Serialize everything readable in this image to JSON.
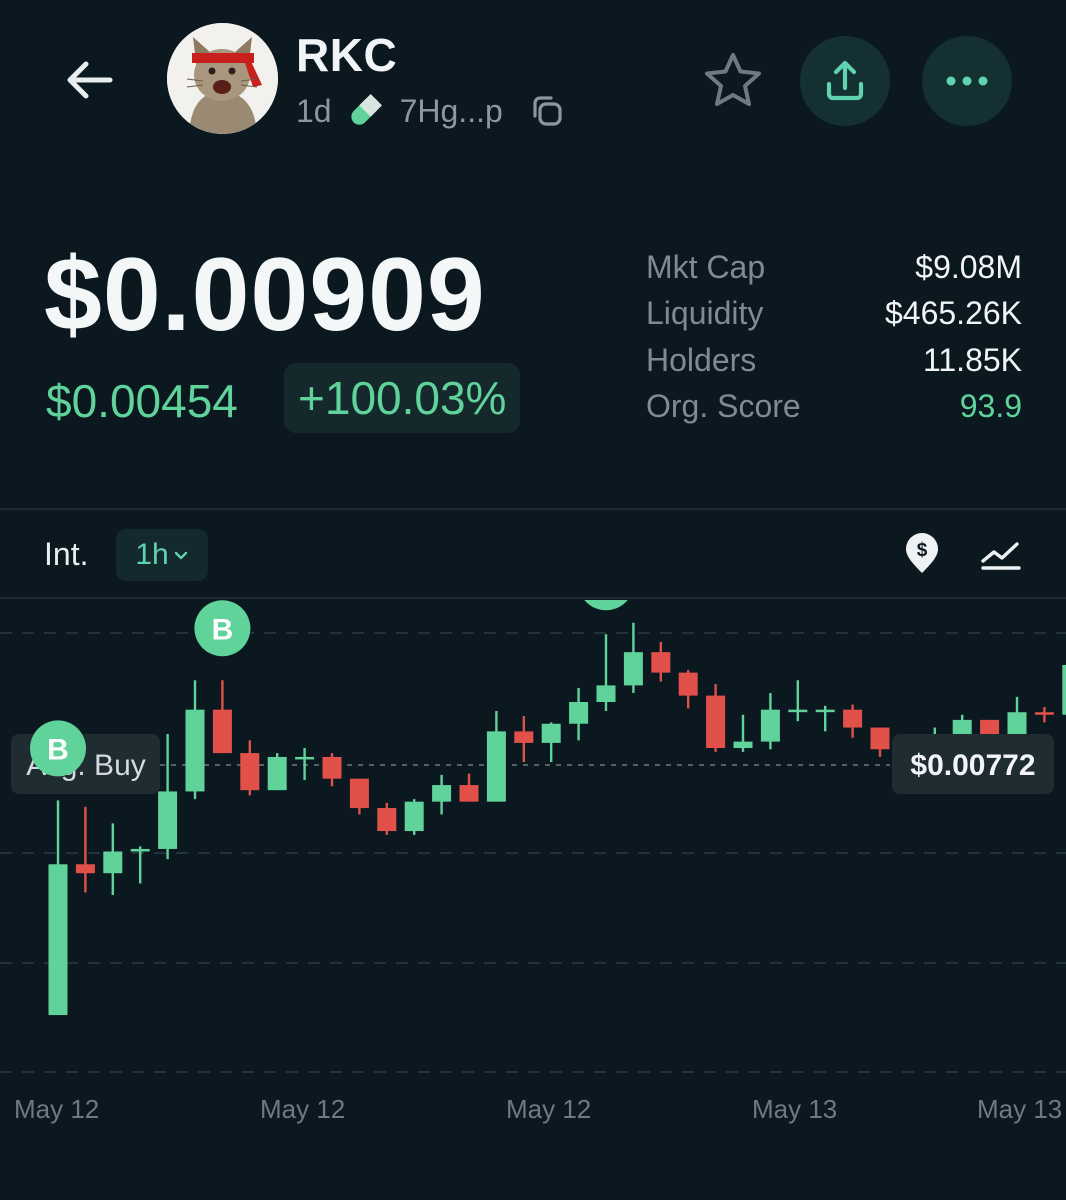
{
  "header": {
    "token_name": "RKC",
    "age": "1d",
    "address": "7Hg...p",
    "icons": {
      "back": "arrow-left-icon",
      "pill": "pill-icon",
      "copy": "copy-icon",
      "star": "star-icon",
      "share": "share-icon",
      "more": "more-icon"
    }
  },
  "price": {
    "current": "$0.00909",
    "previous": "$0.00454",
    "change": "+100.03%"
  },
  "stats": [
    {
      "label": "Mkt Cap",
      "value": "$9.08M"
    },
    {
      "label": "Liquidity",
      "value": "$465.26K"
    },
    {
      "label": "Holders",
      "value": "11.85K"
    },
    {
      "label": "Org. Score",
      "value": "93.9"
    }
  ],
  "interval": {
    "label": "Int.",
    "selected": "1h"
  },
  "colors": {
    "background": "#0b1820",
    "up": "#5fd39a",
    "down": "#e1514a",
    "accent": "#5fd3b0"
  },
  "chart_data": {
    "type": "candlestick",
    "avg_buy_label": "Avg. Buy",
    "price_label": "$0.00772",
    "x_labels": [
      "May 12",
      "May 12",
      "May 12",
      "May 13",
      "May 13"
    ],
    "buy_marker_text": "B",
    "buy_markers": [
      0,
      6,
      20
    ],
    "candles": [
      {
        "o": 0.00423,
        "h": 0.00591,
        "l": 0.00423,
        "c": 0.00541
      },
      {
        "o": 0.00541,
        "h": 0.00586,
        "l": 0.00519,
        "c": 0.00534
      },
      {
        "o": 0.00534,
        "h": 0.00573,
        "l": 0.00517,
        "c": 0.00551
      },
      {
        "o": 0.00551,
        "h": 0.00555,
        "l": 0.00526,
        "c": 0.00553
      },
      {
        "o": 0.00553,
        "h": 0.00643,
        "l": 0.00545,
        "c": 0.00598
      },
      {
        "o": 0.00598,
        "h": 0.00685,
        "l": 0.00592,
        "c": 0.00662
      },
      {
        "o": 0.00662,
        "h": 0.00685,
        "l": 0.00628,
        "c": 0.00628
      },
      {
        "o": 0.00628,
        "h": 0.00638,
        "l": 0.00595,
        "c": 0.00599
      },
      {
        "o": 0.00599,
        "h": 0.00628,
        "l": 0.00599,
        "c": 0.00625
      },
      {
        "o": 0.00625,
        "h": 0.00632,
        "l": 0.00607,
        "c": 0.00625
      },
      {
        "o": 0.00625,
        "h": 0.00628,
        "l": 0.00602,
        "c": 0.00608
      },
      {
        "o": 0.00608,
        "h": 0.00603,
        "l": 0.0058,
        "c": 0.00585
      },
      {
        "o": 0.00585,
        "h": 0.00589,
        "l": 0.00564,
        "c": 0.00567
      },
      {
        "o": 0.00567,
        "h": 0.00592,
        "l": 0.00564,
        "c": 0.0059
      },
      {
        "o": 0.0059,
        "h": 0.00611,
        "l": 0.0058,
        "c": 0.00603
      },
      {
        "o": 0.00603,
        "h": 0.00612,
        "l": 0.00591,
        "c": 0.0059
      },
      {
        "o": 0.0059,
        "h": 0.00661,
        "l": 0.0059,
        "c": 0.00645
      },
      {
        "o": 0.00645,
        "h": 0.00657,
        "l": 0.00621,
        "c": 0.00636
      },
      {
        "o": 0.00636,
        "h": 0.00652,
        "l": 0.00621,
        "c": 0.00651
      },
      {
        "o": 0.00651,
        "h": 0.00679,
        "l": 0.00638,
        "c": 0.00668
      },
      {
        "o": 0.00668,
        "h": 0.00721,
        "l": 0.00661,
        "c": 0.00681
      },
      {
        "o": 0.00681,
        "h": 0.0073,
        "l": 0.00675,
        "c": 0.00707
      },
      {
        "o": 0.00707,
        "h": 0.00715,
        "l": 0.00684,
        "c": 0.00691
      },
      {
        "o": 0.00691,
        "h": 0.00693,
        "l": 0.00663,
        "c": 0.00673
      },
      {
        "o": 0.00673,
        "h": 0.00682,
        "l": 0.00629,
        "c": 0.00632
      },
      {
        "o": 0.00632,
        "h": 0.00658,
        "l": 0.00629,
        "c": 0.00637
      },
      {
        "o": 0.00637,
        "h": 0.00675,
        "l": 0.00631,
        "c": 0.00662
      },
      {
        "o": 0.00662,
        "h": 0.00685,
        "l": 0.00653,
        "c": 0.00662
      },
      {
        "o": 0.00662,
        "h": 0.00665,
        "l": 0.00645,
        "c": 0.00662
      },
      {
        "o": 0.00662,
        "h": 0.00666,
        "l": 0.0064,
        "c": 0.00648
      },
      {
        "o": 0.00648,
        "h": 0.00648,
        "l": 0.00625,
        "c": 0.00631
      },
      {
        "o": 0.00631,
        "h": 0.00637,
        "l": 0.00614,
        "c": 0.00635
      },
      {
        "o": 0.00635,
        "h": 0.00648,
        "l": 0.00632,
        "c": 0.00636
      },
      {
        "o": 0.00636,
        "h": 0.00658,
        "l": 0.00629,
        "c": 0.00654
      },
      {
        "o": 0.00654,
        "h": 0.00654,
        "l": 0.00631,
        "c": 0.00633
      },
      {
        "o": 0.00633,
        "h": 0.00672,
        "l": 0.00627,
        "c": 0.0066
      },
      {
        "o": 0.0066,
        "h": 0.00664,
        "l": 0.00652,
        "c": 0.00658
      },
      {
        "o": 0.00658,
        "h": 0.00697,
        "l": 0.0064,
        "c": 0.00697
      }
    ]
  }
}
